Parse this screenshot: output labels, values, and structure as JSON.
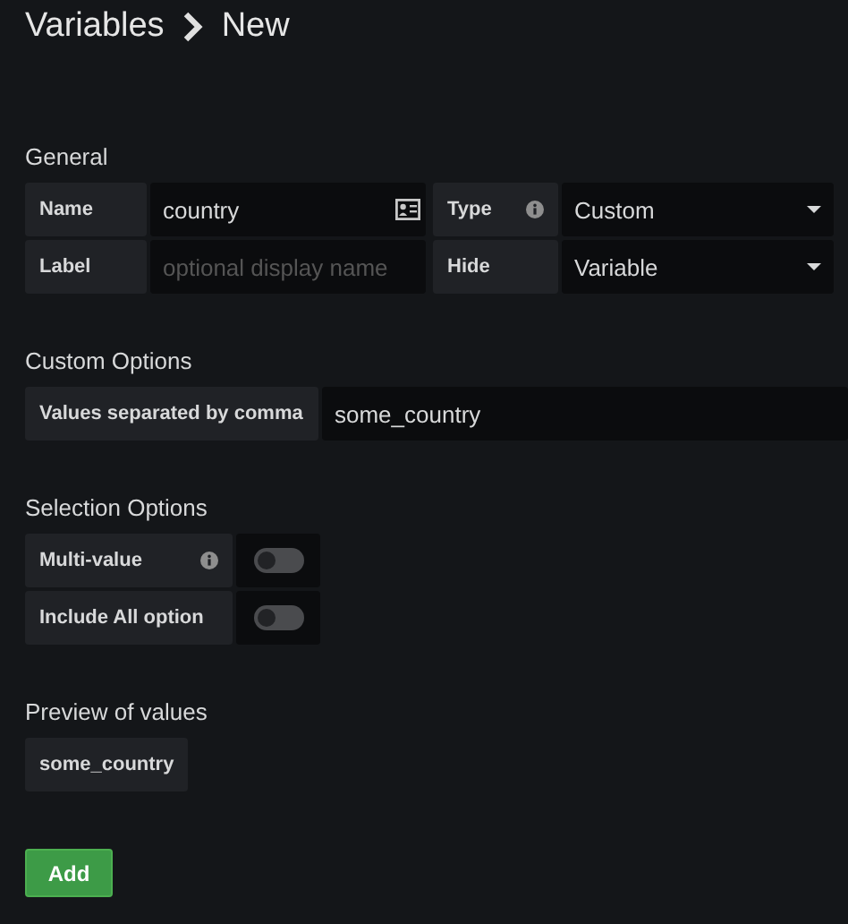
{
  "breadcrumb": {
    "parent": "Variables",
    "current": "New"
  },
  "general": {
    "heading": "General",
    "rows": [
      [
        {
          "label": "Name",
          "kind": "input",
          "value": "country",
          "icon": true
        },
        {
          "label": "Type",
          "kind": "select",
          "value": "Custom",
          "info": true
        }
      ],
      [
        {
          "label": "Label",
          "kind": "input",
          "placeholder": "optional display name"
        },
        {
          "label": "Hide",
          "kind": "select",
          "value": "Variable"
        }
      ]
    ]
  },
  "custom_options": {
    "heading": "Custom Options",
    "label": "Values separated by comma",
    "value": "some_country"
  },
  "selection_options": {
    "heading": "Selection Options",
    "switches": [
      {
        "label": "Multi-value",
        "info": true,
        "on": false
      },
      {
        "label": "Include All option",
        "on": false
      }
    ]
  },
  "preview": {
    "heading": "Preview of values",
    "values": [
      "some_country"
    ]
  },
  "buttons": [
    {
      "label": "Add"
    }
  ]
}
